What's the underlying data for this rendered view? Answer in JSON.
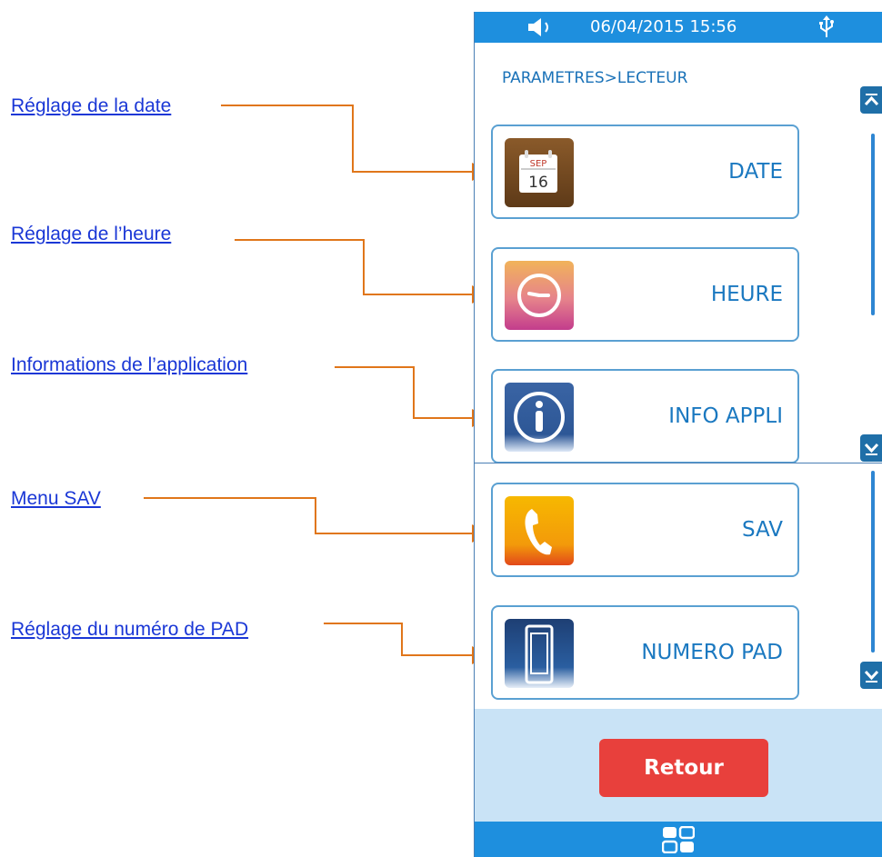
{
  "labels": [
    "Réglage de la date",
    "Réglage de l’heure",
    "Informations de l’application",
    "Menu SAV",
    "Réglage du numéro de PAD"
  ],
  "status_bar": {
    "datetime": "06/04/2015 15:56",
    "sound_icon": "speaker-icon",
    "usb_icon": "usb-icon"
  },
  "breadcrumb": "PARAMETRES>LECTEUR",
  "menu": [
    {
      "title": "DATE",
      "icon": "calendar-icon",
      "icon_month": "SEP",
      "icon_day": "16"
    },
    {
      "title": "HEURE",
      "icon": "clock-icon"
    },
    {
      "title": "INFO APPLI",
      "icon": "info-icon"
    },
    {
      "title": "SAV",
      "icon": "phone-icon"
    },
    {
      "title": "NUMERO PAD",
      "icon": "terminal-icon"
    }
  ],
  "back_button": "Retour",
  "colors": {
    "accent_blue": "#1e8fde",
    "link_blue": "#1a37d6",
    "connector_orange": "#e0761a",
    "back_red": "#e8403c"
  }
}
